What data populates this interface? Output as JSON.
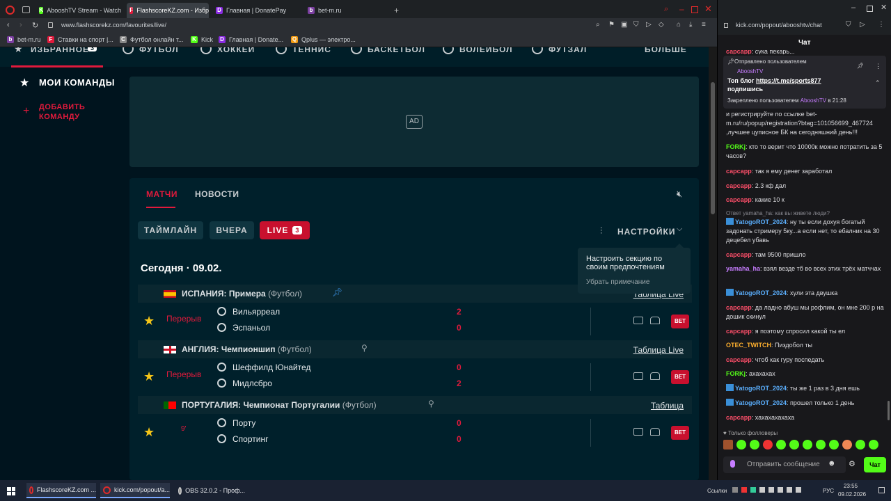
{
  "browser": {
    "tabs": [
      {
        "label": "AbooshTV Stream - Watch",
        "color": "#53fc18",
        "glyph": "K"
      },
      {
        "label": "FlashscoreKZ.com - Избр",
        "color": "#e11a3c",
        "glyph": "F"
      },
      {
        "label": "Главная | DonatePay",
        "color": "#8a2be2",
        "glyph": "D"
      },
      {
        "label": "bet-m.ru",
        "color": "#7b3fa0",
        "glyph": "b"
      }
    ],
    "url": "www.flashscorekz.com/favourites/live/",
    "bookmarks": [
      {
        "label": "bet-m.ru",
        "color": "#7b3fa0",
        "glyph": "b"
      },
      {
        "label": "Ставки на спорт |...",
        "color": "#e11a3c",
        "glyph": "F"
      },
      {
        "label": "Футбол онлайн т...",
        "color": "#888888",
        "glyph": "C"
      },
      {
        "label": "Kick",
        "color": "#53fc18",
        "glyph": "K"
      },
      {
        "label": "Главная | Donate...",
        "color": "#8a2be2",
        "glyph": "D"
      },
      {
        "label": "Qplus — электро...",
        "color": "#f39c12",
        "glyph": "Q"
      }
    ]
  },
  "sportnav": {
    "items": [
      "ИЗБРАННОЕ",
      "ФУТБОЛ",
      "ХОККЕЙ",
      "ТЕННИС",
      "БАСКЕТБОЛ",
      "ВОЛЕЙБОЛ",
      "ФУТЗАЛ",
      "БОЛЬШЕ"
    ],
    "favorites_count": "3"
  },
  "sidebar": {
    "my_teams": "МОИ КОМАНДЫ",
    "add_team_line1": "ДОБАВИТЬ",
    "add_team_line2": "КОМАНДУ"
  },
  "ad": {
    "label": "AD"
  },
  "content": {
    "tabs": [
      "МАТЧИ",
      "НОВОСТИ"
    ],
    "filters": {
      "timeline": "ТАЙМЛАЙН",
      "yesterday": "ВЧЕРА",
      "live": "LIVE",
      "live_count": "3"
    },
    "settings_label": "НАСТРОЙКИ",
    "tooltip_text": "Настроить секцию по своим предпочтениям",
    "tooltip_dismiss": "Убрать примечание",
    "date_heading": "Сегодня · 09.02.",
    "leagues": [
      {
        "country": "ИСПАНИЯ: Примера",
        "sport": "(Футбол)",
        "table_link": "Таблица Live",
        "match": {
          "status": "Перерыв",
          "home": "Вильярреал",
          "away": "Эспаньол",
          "home_score": "2",
          "away_score": "0"
        }
      },
      {
        "country": "АНГЛИЯ: Чемпионшип",
        "sport": "(Футбол)",
        "table_link": "Таблица Live",
        "match": {
          "status": "Перерыв",
          "home": "Шеффилд Юнайтед",
          "away": "Мидлсбро",
          "home_score": "0",
          "away_score": "2"
        }
      },
      {
        "country": "ПОРТУГАЛИЯ: Чемпионат Португалии",
        "sport": "(Футбол)",
        "table_link": "Таблица",
        "match": {
          "status": "9'",
          "home": "Порту",
          "away": "Спортинг",
          "home_score": "0",
          "away_score": "0"
        }
      }
    ],
    "bet_label": "BET"
  },
  "chat": {
    "url": "kick.com/popout/abooshtv/chat",
    "title": "Чат",
    "top_fragment_user": "сарсарр",
    "top_fragment_text": ": сука пекарь...",
    "pinned": {
      "header": "Отправлено пользователем",
      "author": "AbooshTV",
      "text_prefix": "Топ блог ",
      "link": "https://t.me/sports877",
      "text_suffix": "подпишись",
      "footer_prefix": "Закреплено пользователем",
      "footer_author": "AbooshTV",
      "footer_time": "в 21:28"
    },
    "messages": [
      {
        "user": "",
        "text": "и регистрируйте по ссылке bet-m.ru/ru/popup/registration?btag=101056699_467724 ,лучшее цуписное БК на сегодняшний день!!!",
        "color": "#dcdce0"
      },
      {
        "user": "FORKj",
        "text": ": кто то верит что 10000к можно потратить за 5 часов?",
        "color": "#53fc18"
      },
      {
        "user": "сарсарр",
        "text": ": так я ему денег заработал",
        "color": "#ff4f6a"
      },
      {
        "user": "сарсарр",
        "text": ": 2.3 кф дал",
        "color": "#ff4f6a"
      },
      {
        "user": "сарсарр",
        "text": ": какие 10 к",
        "color": "#ff4f6a"
      },
      {
        "user": "YatogoROT_2024",
        "text": ": ну ты если дохуя богатый задонать стримеру 5ку...а если нет, то ебалник на 30 децебел убавь",
        "color": "#5bb0ff",
        "reply": "Ответ yamaha_ha: как вы живете люди?"
      },
      {
        "user": "сарсарр",
        "text": ": там 9500 пришло",
        "color": "#ff4f6a"
      },
      {
        "user": "yamaha_ha",
        "text": ": взял везде тб во всех этих трёх матччах",
        "color": "#c77dff"
      },
      {
        "user": "YatogoROT_2024",
        "text": ": хули эта двушка",
        "color": "#5bb0ff"
      },
      {
        "user": "сарсарр",
        "text": ": да ладно абуш мы рофлим, он мне 200 р на дошик скинул",
        "color": "#ff4f6a"
      },
      {
        "user": "сарсарр",
        "text": ": я поэтому спросил какой ты ел",
        "color": "#ff4f6a"
      },
      {
        "user": "OTEC_TWITCH",
        "text": ": Пиздобол ты",
        "color": "#ffb02e"
      },
      {
        "user": "сарсарр",
        "text": ": чтоб как гуру поспедать",
        "color": "#ff4f6a"
      },
      {
        "user": "FORKj",
        "text": ": ахахахах",
        "color": "#53fc18"
      },
      {
        "user": "YatogoROT_2024",
        "text": ": ты же 1 раз в 3 дня ешь",
        "color": "#5bb0ff"
      },
      {
        "user": "YatogoROT_2024",
        "text": ": прошел только 1 день",
        "color": "#5bb0ff"
      },
      {
        "user": "сарсарр",
        "text": ": хахахахахаха",
        "color": "#ff4f6a"
      }
    ],
    "followers_only": "Только фолловеры",
    "input_placeholder": "Отправить сообщение",
    "send_label": "Чат"
  },
  "taskbar": {
    "items": [
      "FlashscoreKZ.com ...",
      "kick.com/popout/a...",
      "OBS 32.0.2 - Проф..."
    ],
    "links_label": "Ссылки",
    "lang": "РУС",
    "time": "23:55",
    "date": "09.02.2026"
  },
  "colors": {
    "accent": "#e11a3c",
    "kick_green": "#53fc18",
    "star": "#f5c518"
  }
}
